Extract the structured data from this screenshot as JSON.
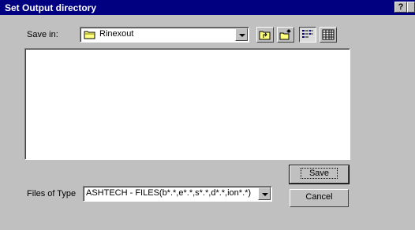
{
  "window": {
    "title": "Set Output directory",
    "help_button": "?",
    "close_button": "✕"
  },
  "save_in": {
    "label": "Save in:",
    "folder": "Rinexout"
  },
  "toolbar": {
    "icons": [
      "up-one-level-icon",
      "create-new-folder-icon",
      "list-view-icon",
      "details-view-icon"
    ]
  },
  "file_list": {
    "items": []
  },
  "files_of_type": {
    "label": "Files of Type",
    "value": "ASHTECH - FILES(b*.*,e*.*,s*.*,d*.*,ion*.*)"
  },
  "buttons": {
    "save": "Save",
    "cancel": "Cancel"
  }
}
